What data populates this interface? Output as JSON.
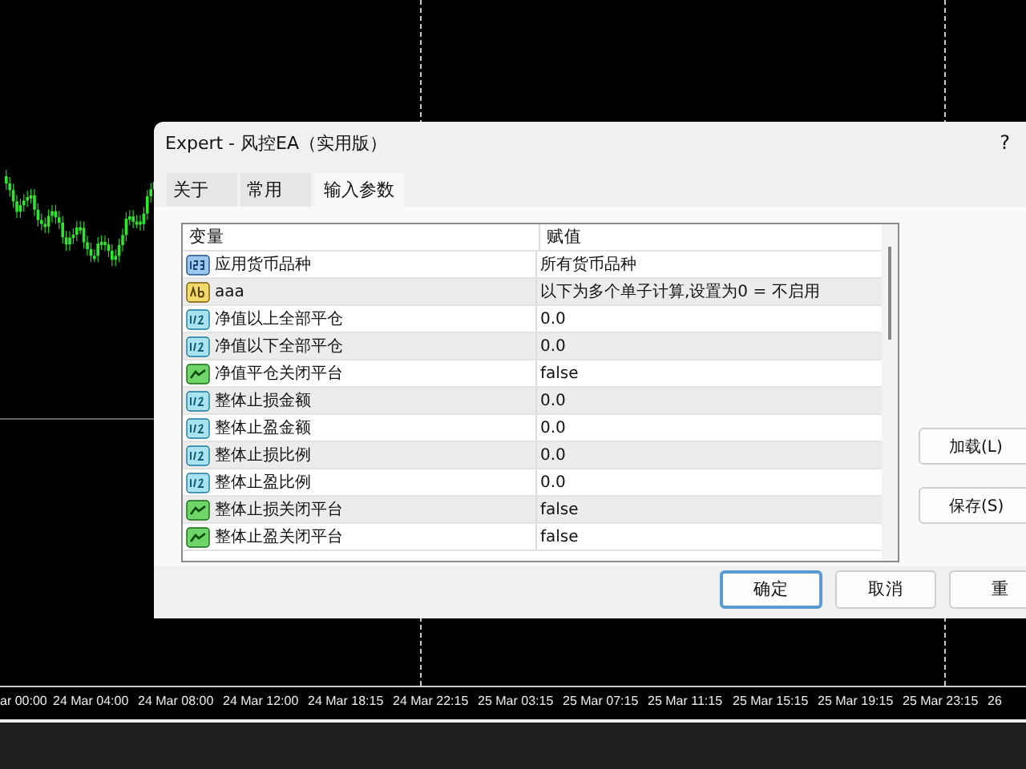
{
  "chart": {
    "time_axis": [
      "ar 00:00",
      "24 Mar 04:00",
      "24 Mar 08:00",
      "24 Mar 12:00",
      "24 Mar 18:15",
      "24 Mar 22:15",
      "25 Mar 03:15",
      "25 Mar 07:15",
      "25 Mar 11:15",
      "25 Mar 15:15",
      "25 Mar 19:15",
      "25 Mar 23:15",
      "26"
    ]
  },
  "dialog": {
    "title": "Expert - 风控EA（实用版）",
    "help": "?",
    "tabs": [
      {
        "label": "关于",
        "selected": false
      },
      {
        "label": "常用",
        "selected": false
      },
      {
        "label": "输入参数",
        "selected": true
      }
    ],
    "table": {
      "columns": [
        "变量",
        "赋值"
      ],
      "rows": [
        {
          "kind": "int",
          "name": "应用货币品种",
          "value": "所有货币品种"
        },
        {
          "kind": "string",
          "name": "aaa",
          "value": "以下为多个单子计算,设置为0 = 不启用"
        },
        {
          "kind": "double",
          "name": "净值以上全部平仓",
          "value": "0.0"
        },
        {
          "kind": "double",
          "name": "净值以下全部平仓",
          "value": "0.0"
        },
        {
          "kind": "bool",
          "name": "净值平仓关闭平台",
          "value": "false"
        },
        {
          "kind": "double",
          "name": "整体止损金额",
          "value": "0.0"
        },
        {
          "kind": "double",
          "name": "整体止盈金额",
          "value": "0.0"
        },
        {
          "kind": "double",
          "name": "整体止损比例",
          "value": "0.0"
        },
        {
          "kind": "double",
          "name": "整体止盈比例",
          "value": "0.0"
        },
        {
          "kind": "bool",
          "name": "整体止损关闭平台",
          "value": "false"
        },
        {
          "kind": "bool",
          "name": "整体止盈关闭平台",
          "value": "false"
        }
      ]
    },
    "side_buttons": [
      "加载(L)",
      "保存(S)"
    ],
    "buttons": [
      {
        "label": "确定",
        "default": true
      },
      {
        "label": "取消",
        "default": false
      },
      {
        "label": "重",
        "default": false
      }
    ]
  }
}
